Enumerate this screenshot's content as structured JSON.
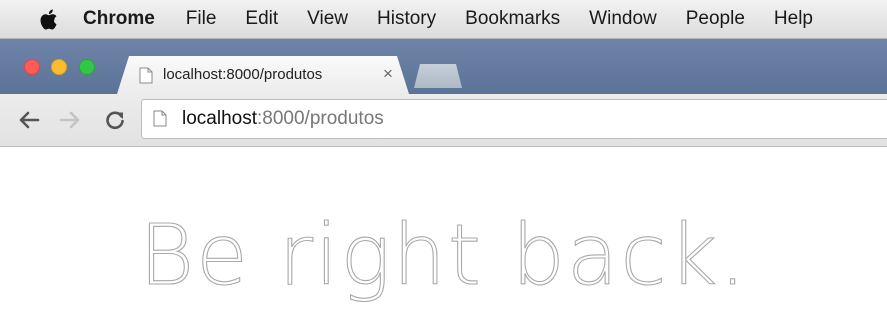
{
  "menubar": {
    "app_name": "Chrome",
    "items": [
      "File",
      "Edit",
      "View",
      "History",
      "Bookmarks",
      "Window",
      "People",
      "Help"
    ]
  },
  "tab": {
    "title": "localhost:8000/produtos",
    "close_glyph": "×"
  },
  "omnibox": {
    "host": "localhost",
    "path": ":8000/produtos"
  },
  "page": {
    "headline": "Be right back."
  },
  "icons": {
    "apple": "apple-logo-icon",
    "back": "back-arrow-icon",
    "forward": "forward-arrow-icon",
    "reload": "reload-icon",
    "page": "page-icon"
  },
  "colors": {
    "tabstrip": "#6e84a8",
    "close_red": "#fc5b57",
    "minimize_yellow": "#fdbc2e",
    "zoom_green": "#33c748",
    "headline_stroke": "#a9a9a9"
  }
}
